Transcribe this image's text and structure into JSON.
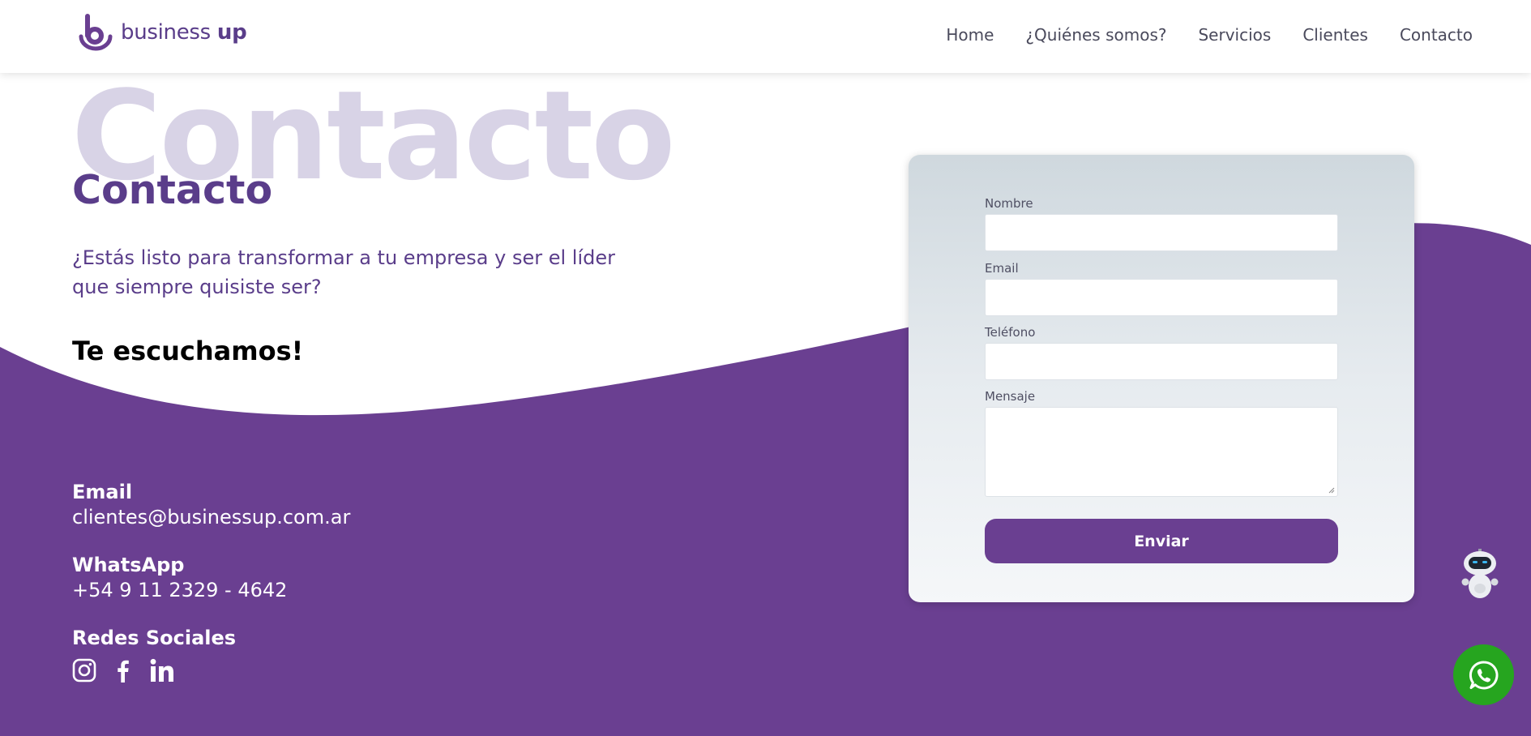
{
  "brand": {
    "name_part1": "business",
    "name_part2": "up"
  },
  "nav": [
    {
      "label": "Home"
    },
    {
      "label": "¿Quiénes somos?"
    },
    {
      "label": "Servicios"
    },
    {
      "label": "Clientes"
    },
    {
      "label": "Contacto"
    }
  ],
  "hero": {
    "background_word": "Contacto",
    "title": "Contacto",
    "lead": "¿Estás listo para transformar a tu empresa y ser el líder que siempre quisiste ser?",
    "subheading": "Te escuchamos!"
  },
  "contact_info": {
    "email_label": "Email",
    "email_value": "clientes@businessup.com.ar",
    "whatsapp_label": "WhatsApp",
    "whatsapp_value": "+54 9 11 2329 - 4642",
    "social_label": "Redes Sociales",
    "social_icons": [
      "instagram-icon",
      "facebook-icon",
      "linkedin-icon"
    ]
  },
  "form": {
    "fields": [
      {
        "label": "Nombre",
        "value": ""
      },
      {
        "label": "Email",
        "value": ""
      },
      {
        "label": "Teléfono",
        "value": ""
      },
      {
        "label": "Mensaje",
        "value": ""
      }
    ],
    "submit_label": "Enviar"
  },
  "floating": {
    "chatbot": "robot-icon",
    "whatsapp": "whatsapp-icon"
  },
  "colors": {
    "brand_purple": "#6a3f91",
    "heading_purple": "#5a3d8a",
    "watermark": "#d8d3e6",
    "whatsapp_green": "#26a51f",
    "white": "#ffffff"
  }
}
